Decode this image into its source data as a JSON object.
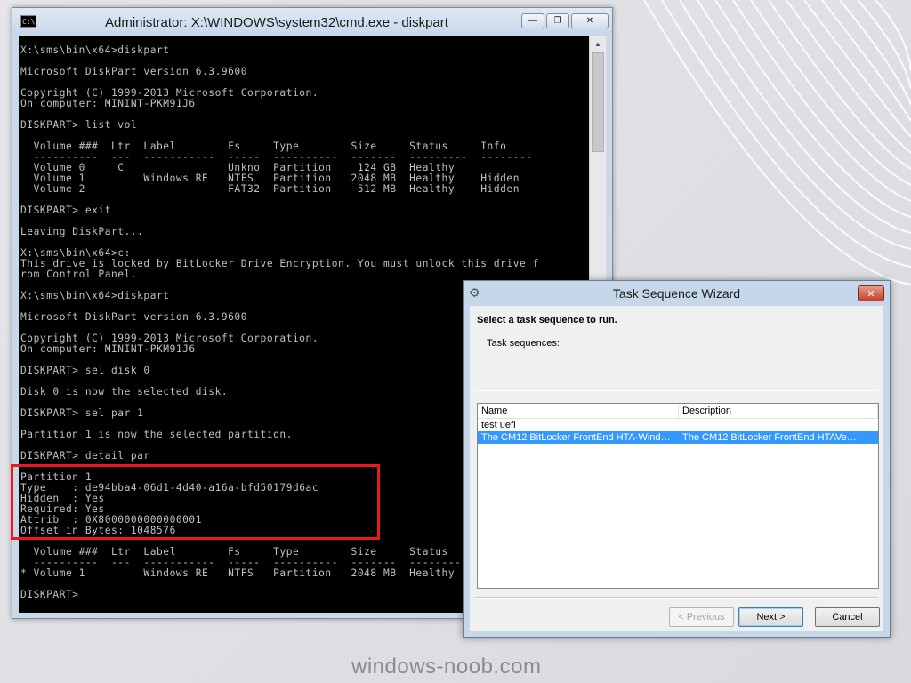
{
  "cmd": {
    "title": "Administrator: X:\\WINDOWS\\system32\\cmd.exe - diskpart",
    "icon_text": "C:\\",
    "controls": {
      "minimize": "—",
      "restore": "❐",
      "close": "✕"
    },
    "console_text": "X:\\sms\\bin\\x64>diskpart\n\nMicrosoft DiskPart version 6.3.9600\n\nCopyright (C) 1999-2013 Microsoft Corporation.\nOn computer: MININT-PKM91J6\n\nDISKPART> list vol\n\n  Volume ###  Ltr  Label        Fs     Type        Size     Status     Info\n  ----------  ---  -----------  -----  ----------  -------  ---------  --------\n  Volume 0     C                Unkno  Partition    124 GB  Healthy\n  Volume 1         Windows RE   NTFS   Partition   2048 MB  Healthy    Hidden\n  Volume 2                      FAT32  Partition    512 MB  Healthy    Hidden\n\nDISKPART> exit\n\nLeaving DiskPart...\n\nX:\\sms\\bin\\x64>c:\nThis drive is locked by BitLocker Drive Encryption. You must unlock this drive f\nrom Control Panel.\n\nX:\\sms\\bin\\x64>diskpart\n\nMicrosoft DiskPart version 6.3.9600\n\nCopyright (C) 1999-2013 Microsoft Corporation.\nOn computer: MININT-PKM91J6\n\nDISKPART> sel disk 0\n\nDisk 0 is now the selected disk.\n\nDISKPART> sel par 1\n\nPartition 1 is now the selected partition.\n\nDISKPART> detail par\n\nPartition 1\nType    : de94bba4-06d1-4d40-a16a-bfd50179d6ac\nHidden  : Yes\nRequired: Yes\nAttrib  : 0X8000000000000001\nOffset in Bytes: 1048576\n\n  Volume ###  Ltr  Label        Fs     Type        Size     Status     Info\n  ----------  ---  -----------  -----  ----------  -------  ---------  --------\n* Volume 1         Windows RE   NTFS   Partition   2048 MB  Healthy    Hidden\n\nDISKPART>"
  },
  "wizard": {
    "title": "Task Sequence Wizard",
    "close": "✕",
    "heading": "Select a task sequence to run.",
    "sublabel": "Task sequences:",
    "columns": [
      "Name",
      "Description"
    ],
    "rows": [
      {
        "name": "test uefi",
        "description": "",
        "selected": false
      },
      {
        "name": "The CM12 BitLocker FrontEnd HTA-Window…",
        "description": "The CM12 BitLocker FrontEnd HTAVe…",
        "selected": true
      }
    ],
    "buttons": {
      "previous": "< Previous",
      "next": "Next >",
      "cancel": "Cancel"
    }
  },
  "watermark": "windows-noob.com",
  "colors": {
    "highlight": "#e8191f",
    "selection": "#3399ff",
    "console_bg": "#000000",
    "console_fg": "#c0c0c0"
  }
}
